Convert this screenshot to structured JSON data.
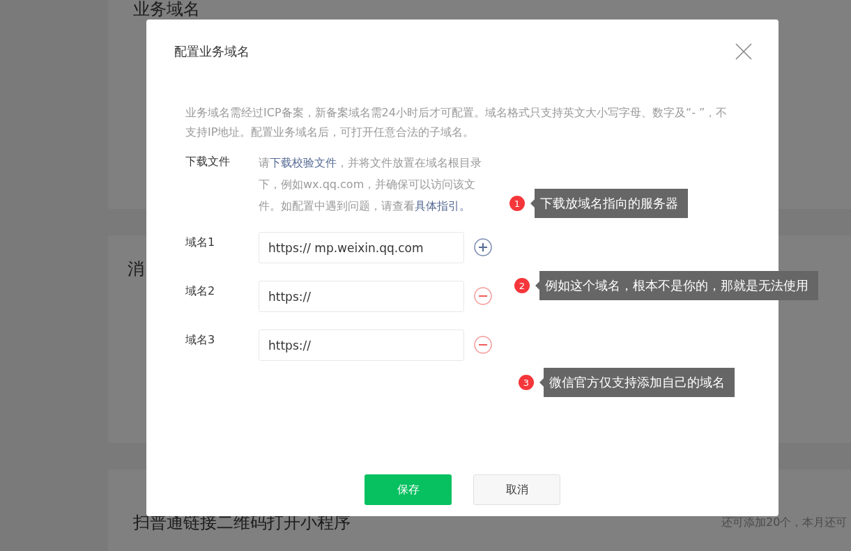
{
  "background_page": {
    "sections": [
      {
        "title": "业务域名"
      },
      {
        "title": "消"
      },
      {
        "title": "扫普通链接二维码打开小程序",
        "note": "还可添加20个，本月还可"
      }
    ]
  },
  "dialog": {
    "title": "配置业务域名",
    "description": "业务域名需经过ICP备案，新备案域名需24小时后才可配置。域名格式只支持英文大小写字母、数字及“- ”，不支持IP地址。配置业务域名后，可打开任意合法的子域名。",
    "download": {
      "label": "下载文件",
      "segments": [
        {
          "text": "请",
          "kind": "plain"
        },
        {
          "text": "下载校验文件",
          "kind": "link"
        },
        {
          "text": "，并将文件放置在域名根目录下，例如wx.qq.com，并确保可以访问该文件。如配置中遇到问题，请查看",
          "kind": "plain"
        },
        {
          "text": "具体指引。",
          "kind": "link"
        }
      ]
    },
    "domains": [
      {
        "label": "域名1",
        "value": "https:// mp.weixin.qq.com",
        "kind": "add"
      },
      {
        "label": "域名2",
        "value": "https://",
        "kind": "remove"
      },
      {
        "label": "域名3",
        "value": "https://",
        "kind": "remove"
      }
    ],
    "buttons": [
      {
        "label": "保存",
        "kind": "primary"
      },
      {
        "label": "取消",
        "kind": "default"
      }
    ]
  },
  "annotations": [
    {
      "number": "1",
      "text": "下载放域名指向的服务器"
    },
    {
      "number": "2",
      "text": "例如这个域名，根本不是你的，那就是无法使用"
    },
    {
      "number": "3",
      "text": "微信官方仅支持添加自己的域名"
    }
  ]
}
